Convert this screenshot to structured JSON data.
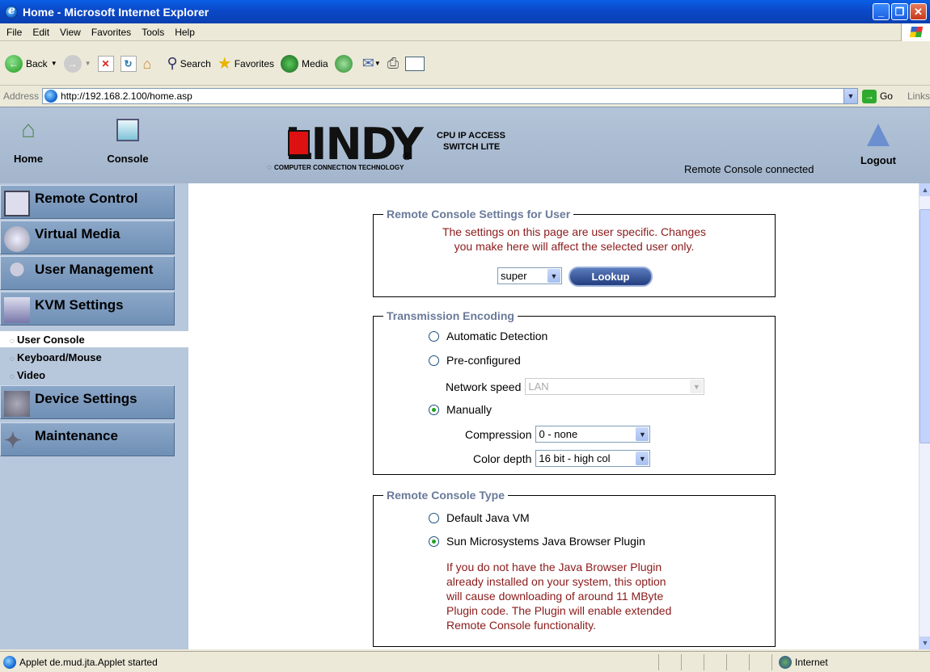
{
  "window": {
    "title": "Home - Microsoft Internet Explorer"
  },
  "menu": [
    "File",
    "Edit",
    "View",
    "Favorites",
    "Tools",
    "Help"
  ],
  "toolbar": {
    "back": "Back",
    "search": "Search",
    "favorites": "Favorites",
    "media": "Media"
  },
  "address": {
    "label": "Address",
    "url": "http://192.168.2.100/home.asp",
    "go": "Go",
    "links": "Links"
  },
  "header": {
    "home": "Home",
    "console": "Console",
    "logout": "Logout",
    "status": "Remote Console connected",
    "logo_main": "LINDY",
    "logo_sub": "COMPUTER CONNECTION TECHNOLOGY",
    "product_line1": "CPU IP ACCESS",
    "product_line2": "SWITCH LITE"
  },
  "sidebar": {
    "items": [
      "Remote Control",
      "Virtual Media",
      "User Management",
      "KVM Settings",
      "Device Settings",
      "Maintenance"
    ],
    "subitems": [
      "User Console",
      "Keyboard/Mouse",
      "Video"
    ]
  },
  "user_section": {
    "legend": "Remote Console Settings for User",
    "note_line1": "The settings on this page are user specific. Changes",
    "note_line2": "you make here will affect the selected user only.",
    "user": "super",
    "lookup": "Lookup"
  },
  "encoding": {
    "legend": "Transmission Encoding",
    "auto": "Automatic Detection",
    "preconf": "Pre-configured",
    "netspeed_label": "Network speed",
    "netspeed": "LAN",
    "manual": "Manually",
    "compression_label": "Compression",
    "compression": "0 - none",
    "depth_label": "Color depth",
    "depth": "16 bit - high col",
    "selected": "manual"
  },
  "console_type": {
    "legend": "Remote Console Type",
    "java": "Default Java VM",
    "sun": "Sun Microsystems Java Browser Plugin",
    "selected": "sun",
    "note": [
      "If you do not have the Java Browser Plugin",
      "already installed on your system, this option",
      "will cause downloading of around 11 MByte",
      "Plugin code. The Plugin will enable extended",
      "Remote Console functionality."
    ]
  },
  "status": {
    "text": "Applet de.mud.jta.Applet started",
    "zone": "Internet"
  }
}
